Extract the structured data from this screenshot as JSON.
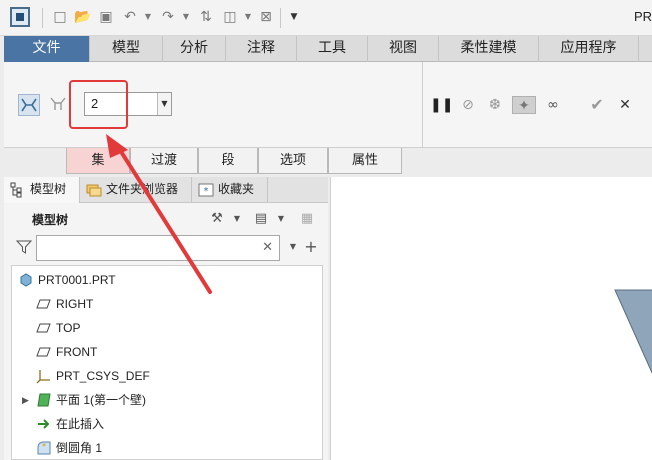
{
  "window": {
    "title_fragment": "PR"
  },
  "ribbon_tabs": [
    "文件",
    "模型",
    "分析",
    "注释",
    "工具",
    "视图",
    "柔性建模",
    "应用程序"
  ],
  "ribbon": {
    "count_value": "2"
  },
  "sub_tabs": [
    "集",
    "过渡",
    "段",
    "选项",
    "属性"
  ],
  "panel_tabs": [
    "模型树",
    "文件夹浏览器",
    "收藏夹"
  ],
  "model_tree": {
    "title": "模型树",
    "search_placeholder": "",
    "nodes": [
      {
        "label": "PRT0001.PRT",
        "icon": "part-icon"
      },
      {
        "label": "RIGHT",
        "icon": "datum-plane-icon"
      },
      {
        "label": "TOP",
        "icon": "datum-plane-icon"
      },
      {
        "label": "FRONT",
        "icon": "datum-plane-icon"
      },
      {
        "label": "PRT_CSYS_DEF",
        "icon": "csys-icon"
      },
      {
        "label": "平面 1(第一个壁)",
        "icon": "sheetmetal-wall-icon"
      },
      {
        "label": "在此插入",
        "icon": "insert-here-icon"
      },
      {
        "label": "倒圆角 1",
        "icon": "round-icon"
      }
    ]
  },
  "colors": {
    "file_tab": "#4a74a4",
    "annotation_red": "#e23a3a",
    "active_subtab": "#f7d3d3"
  }
}
